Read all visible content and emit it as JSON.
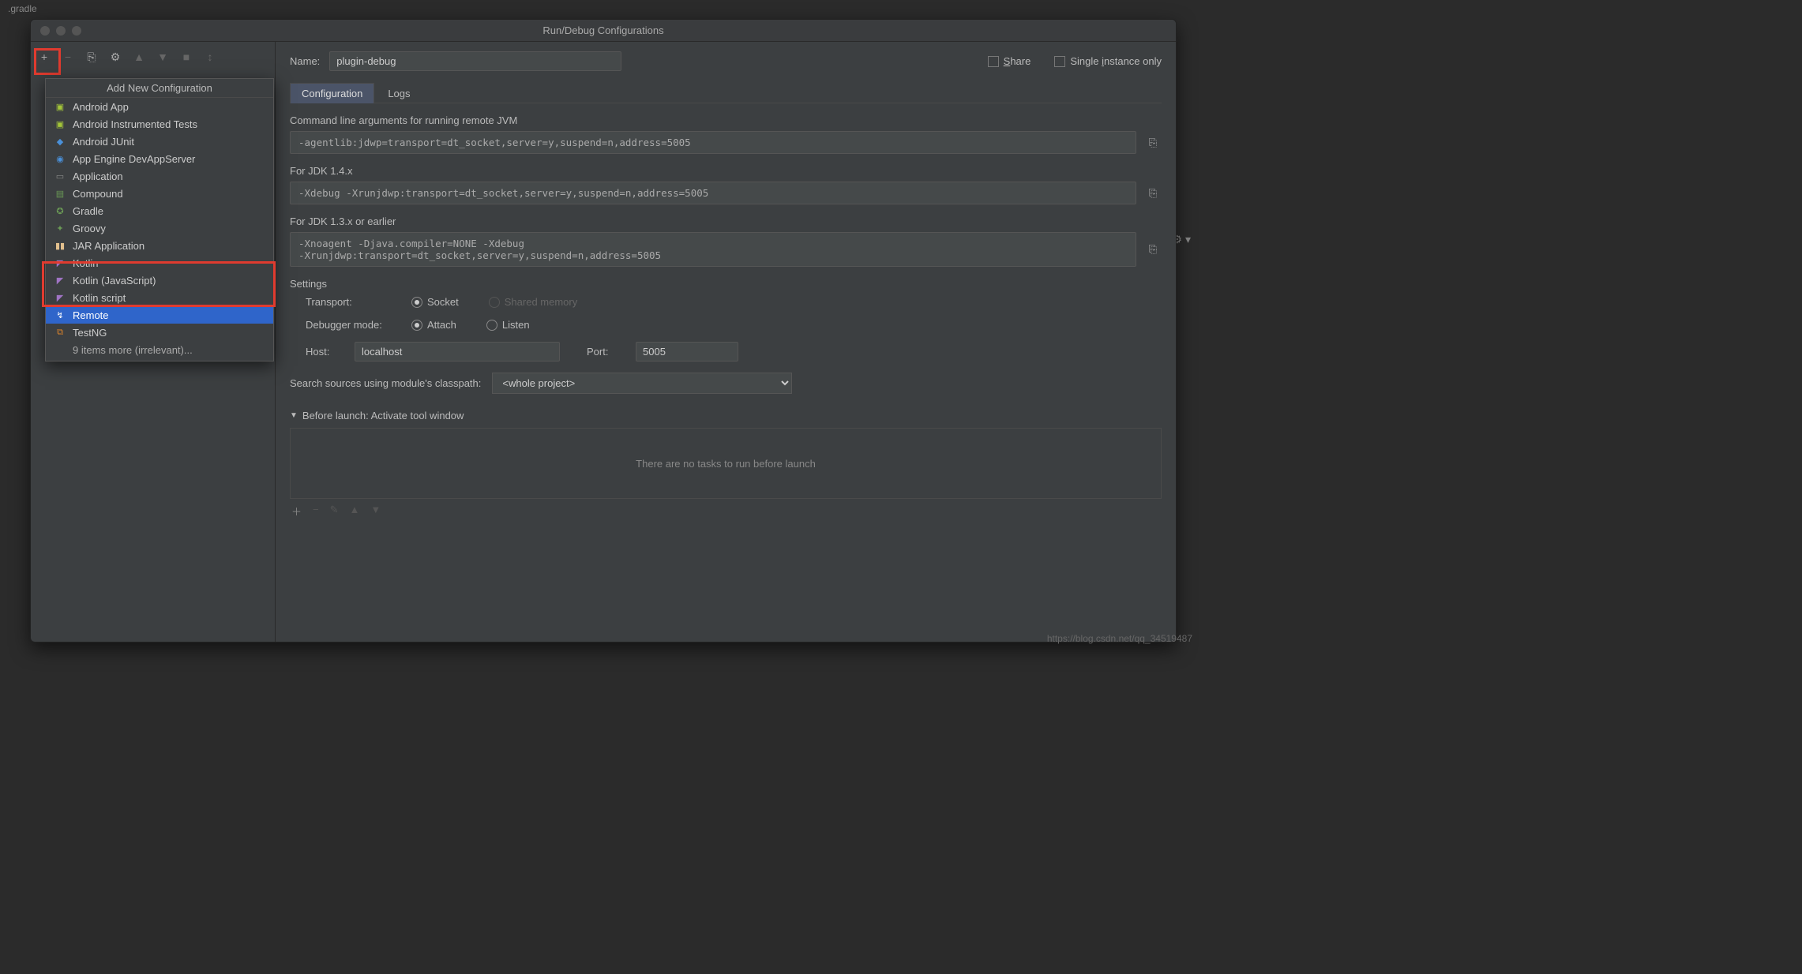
{
  "bg_tab": ".gradle",
  "dialog": {
    "title": "Run/Debug Configurations"
  },
  "toolbar_icons": [
    "+",
    "−",
    "⎘",
    "⚙",
    "▲",
    "▼",
    "■",
    "↕"
  ],
  "popup": {
    "header": "Add New Configuration",
    "items": [
      {
        "label": "Android App"
      },
      {
        "label": "Android Instrumented Tests"
      },
      {
        "label": "Android JUnit"
      },
      {
        "label": "App Engine DevAppServer"
      },
      {
        "label": "Application"
      },
      {
        "label": "Compound"
      },
      {
        "label": "Gradle"
      },
      {
        "label": "Groovy"
      },
      {
        "label": "JAR Application"
      },
      {
        "label": "Kotlin"
      },
      {
        "label": "Kotlin (JavaScript)"
      },
      {
        "label": "Kotlin script"
      },
      {
        "label": "Remote"
      },
      {
        "label": "TestNG"
      }
    ],
    "more": "9 items more (irrelevant)..."
  },
  "form": {
    "name_label": "Name:",
    "name_value": "plugin-debug",
    "share_label": "Share",
    "single_instance_label": "Single instance only"
  },
  "tabs": {
    "configuration": "Configuration",
    "logs": "Logs"
  },
  "cmd": {
    "heading1": "Command line arguments for running remote JVM",
    "val1": "-agentlib:jdwp=transport=dt_socket,server=y,suspend=n,address=5005",
    "heading2": "For JDK 1.4.x",
    "val2": "-Xdebug -Xrunjdwp:transport=dt_socket,server=y,suspend=n,address=5005",
    "heading3": "For JDK 1.3.x or earlier",
    "val3": "-Xnoagent -Djava.compiler=NONE -Xdebug\n-Xrunjdwp:transport=dt_socket,server=y,suspend=n,address=5005"
  },
  "settings": {
    "heading": "Settings",
    "transport_label": "Transport:",
    "transport_socket": "Socket",
    "transport_shared": "Shared memory",
    "debugger_label": "Debugger mode:",
    "debugger_attach": "Attach",
    "debugger_listen": "Listen",
    "host_label": "Host:",
    "host_value": "localhost",
    "port_label": "Port:",
    "port_value": "5005",
    "search_label": "Search sources using module's classpath:",
    "search_value": "<whole project>"
  },
  "before_launch": {
    "heading": "Before launch: Activate tool window",
    "empty": "There are no tasks to run before launch"
  },
  "watermark": "https://blog.csdn.net/qq_34519487"
}
